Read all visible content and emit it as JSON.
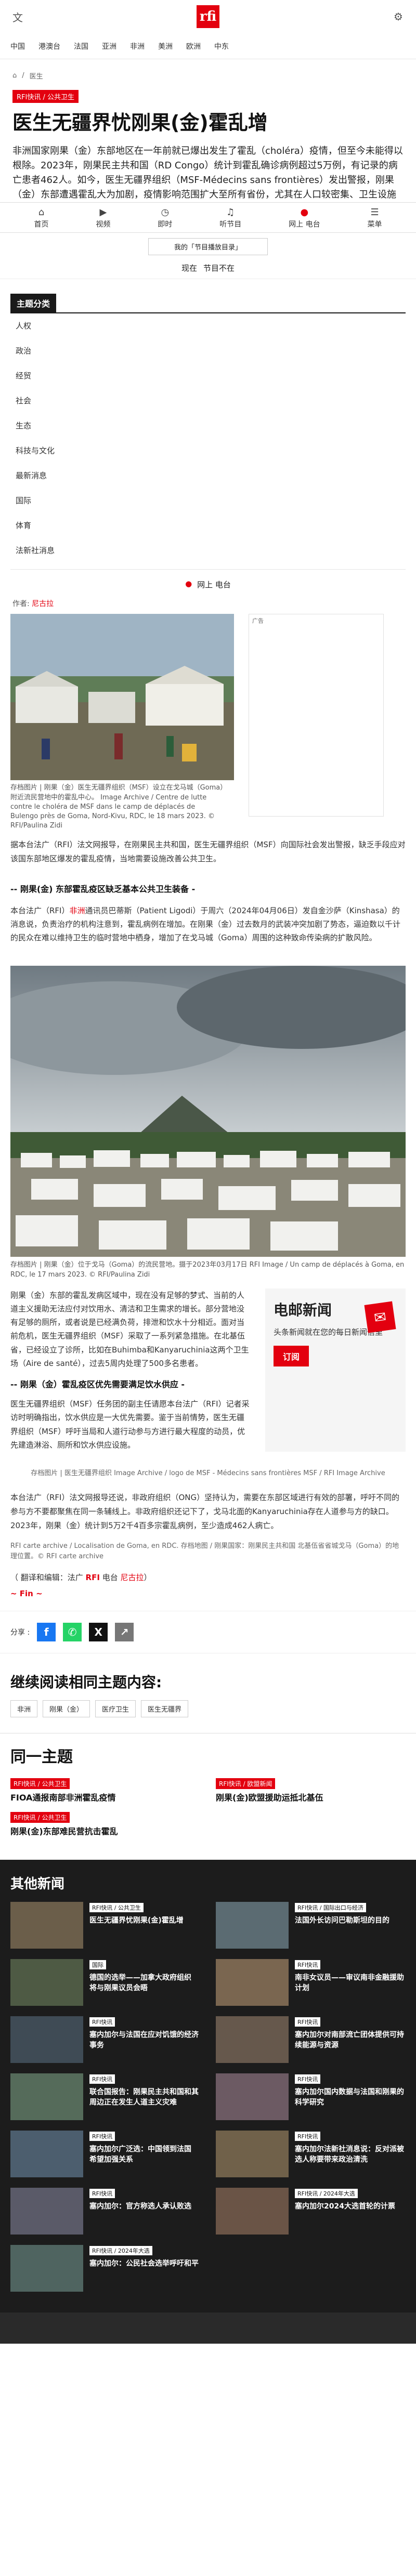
{
  "header": {
    "logo": "rfi",
    "nav": [
      "中国",
      "港澳台",
      "法国",
      "亚洲",
      "非洲",
      "美洲",
      "欧洲",
      "中东"
    ]
  },
  "breadcrumb": {
    "home_icon": "home-icon",
    "section": "医生"
  },
  "tags": [
    "RFI快讯",
    "公共卫生"
  ],
  "article": {
    "title": "医生无疆界忧刚果(金)霍乱增",
    "lead": "非洲国家刚果（金）东部地区在一年前就已爆出发生了霍乱（choléra）疫情，但至今未能得以根除。2023年，刚果民主共和国（RD Congo）统计到霍乱确诊病例超过5万例，有记录的病亡患者462人。如今，医生无疆界组织（MSF-Médecins sans frontières）发出警报，刚果（金）东部遭遇霍乱大为加剧，疫情影响范围扩大至所有省份，尤其在人口较密集、卫生设施匮乏地区霍乱风险极大。这些地区包括流民营地，难民营等。"
  },
  "sticky_nav": [
    {
      "icon": "home-icon",
      "label": "首页"
    },
    {
      "icon": "video-icon",
      "label": "视频"
    },
    {
      "icon": "clock-icon",
      "label": "即时"
    },
    {
      "icon": "headphones-icon",
      "label": "听节目"
    },
    {
      "icon": "live-icon",
      "label": "网上 电台"
    },
    {
      "icon": "menu-icon",
      "label": "菜单"
    }
  ],
  "program_box": "我的「节目播放目录」",
  "now_row": {
    "label": "现在",
    "value": "节目不在",
    "live_label": "网上 电台"
  },
  "categories": {
    "title": "主题分类",
    "items": [
      "人权",
      "政治",
      "经贸",
      "社会",
      "生态",
      "科技与文化",
      "最新消息",
      "国际",
      "体育",
      "法新社消息"
    ]
  },
  "byline": {
    "prefix": "作者:",
    "author": "尼古拉"
  },
  "ad_label": "广告",
  "photo1_caption": "存档图片 | 刚果（金）医生无疆界组织（MSF）设立在戈马城（Goma）附近流民营地中的霍乱中心。 Image Archive / Centre de lutte contre le choléra de MSF dans le camp de déplacés de Bulengo près de Goma, Nord-Kivu, RDC, le 18 mars 2023. © RFI/Paulina Zidi",
  "para1": "据本台法广（RFI）法文网报导，在刚果民主共和国，医生无疆界组织（MSF）向国际社会发出警报，缺乏手段应对该国东部地区爆发的霍乱疫情，当地需要设施改善公共卫生。",
  "subhead1": "-- 刚果(金) 东部霍乱疫区缺乏基本公共卫生装备 -",
  "para2_a": "本台法广（RFI）",
  "para2_b": "非洲",
  "para2_c": "通讯员巴蒂斯（Patient Ligodi）于周六（2024年04月06日）发自金沙萨（Kinshasa）的消息说，负责治疗的机构注意到，霍乱病例在增加。在刚果（金）过去数月的武装冲突加剧了势态，逼迫数以千计的民众在难以维持卫生的临时营地中栖身，增加了在戈马城（Goma）周围的这种致命传染病的扩散风险。",
  "photo2_caption": "存档图片 | 刚果（金）位于戈马（Goma）的流民营地。摄于2023年03月17日 RFI Image / Un camp de déplacés à Goma, en RDC, le 17 mars 2023. © RFI/Paulina Zidi",
  "para3": "刚果（金）东部的霍乱发病区域中，现在没有足够的梦式、当前的人道主义援助无法应付对饮用水、清洁和卫生需求的增长。部分营地没有足够的厕所，或者说是已经满负荷，排泄和饮水十分相近。面对当前危机，医生无疆界组织（MSF）采取了一系列紧急措施。在北基伍省，已经设立了诊所，比如在Buhimba和Kanyaruchinia这两个卫生场（Aire de santé），过去5周内处理了500多名患者。",
  "subhead2": "-- 刚果（金）霍乱疫区优先需要满足饮水供应 -",
  "para4": "医生无疆界组织（MSF）任务团的副主任请愿本台法广（RFI）记者采访时明确指出，饮水供应是一大优先需要。鉴于当前情势，医生无疆界组织（MSF）呼吁当局和人道行动参与方进行最大程度的动员，优先建造淋浴、厕所和饮水供应设施。",
  "newsletter": {
    "title": "电邮新闻",
    "text": "头条新闻就在您的每日新闻信里",
    "button": "订阅"
  },
  "logo_band": "存档图片 | 医生无疆界组织 Image Archive / logo de MSF - Médecins sans frontières MSF / RFI Image Archive",
  "para5": "本台法广（RFI）法文网报导还说，非政府组织（ONG）坚持认为，需要在东部区域进行有效的部署，呼吁不同的参与方不要都聚焦在同一条辅线上。非政府组织还记下了，戈马北面的Kanyaruchinia存在人道参与方的缺口。2023年，刚果（金）统计到5万2千4百多宗霍乱病例，至少造成462人病亡。",
  "photo_credit": "RFI carte archive / Localisation de Goma, en RDC. 存档地图 / 刚果国家：刚果民主共和国 北基伍省省城戈马（Goma）的地理位置。© RFI carte archive",
  "translation": {
    "prefix": "（ 翻译和编辑：法广 ",
    "rfi": "RFI",
    "middle": " 电台 ",
    "name": "尼古拉",
    "suffix": "）"
  },
  "fin": "~ Fin ~",
  "share": {
    "label": "分享 :",
    "buttons": [
      "facebook-icon",
      "whatsapp-icon",
      "x-icon",
      "share-icon"
    ]
  },
  "keep_reading": "继续阅读相同主题内容:",
  "keep_chips": [
    "非洲",
    "刚果（金）",
    "医疗卫生",
    "医生无疆界"
  ],
  "same_topic": {
    "title": "同一主题",
    "items": [
      {
        "tag": "RFI快讯 / 公共卫生",
        "title": "FIOA通报南部非洲霍乱疫情"
      },
      {
        "tag": "RFI快讯 / 欧盟新闻",
        "title": "刚果(金)欧盟援助运抵北基伍"
      },
      {
        "tag": "RFI快讯 / 公共卫生",
        "title": "刚果(金)东部难民营抗击霍乱"
      }
    ]
  },
  "other_news": {
    "title": "其他新闻",
    "items": [
      {
        "tag": "RFI快讯 / 公共卫生",
        "title": "医生无疆界忧刚果(金)霍乱增"
      },
      {
        "tag": "RFI快讯 / 国际出口与经济",
        "title": "法国外长访问巴勒斯坦的目的"
      },
      {
        "tag": "国际",
        "title": "德国的选举——加拿大政府组织 将与刚果议员会晤"
      },
      {
        "tag": "RFI快讯",
        "title": "南非女议员——审议南非金融援助计划"
      },
      {
        "tag": "RFI快讯",
        "title": "塞内加尔与法国在应对饥饿的经济事务"
      },
      {
        "tag": "RFI快讯",
        "title": "塞内加尔对南部流亡团体提供可持续能源与资源"
      },
      {
        "tag": "RFI快讯",
        "title": "联合国报告：刚果民主共和国和其周边正在发生人道主义灾难"
      },
      {
        "tag": "RFI快讯",
        "title": "塞内加尔国内数据与法国和刚果的科学研究"
      },
      {
        "tag": "RFI快讯",
        "title": "塞内加尔广泛选：中国领到法国 希望加强关系"
      },
      {
        "tag": "RFI快讯",
        "title": "塞内加尔法新社消息说：反对派被选人称要带来政治清洗"
      },
      {
        "tag": "RFI快讯",
        "title": "塞内加尔：官方称选人承认败选"
      },
      {
        "tag": "RFI快讯 / 2024年大选",
        "title": "塞内加尔2024大选首轮的计票"
      },
      {
        "tag": "RFI快讯 / 2024年大选",
        "title": "塞内加尔：公民社会选举呼吁和平"
      }
    ]
  }
}
